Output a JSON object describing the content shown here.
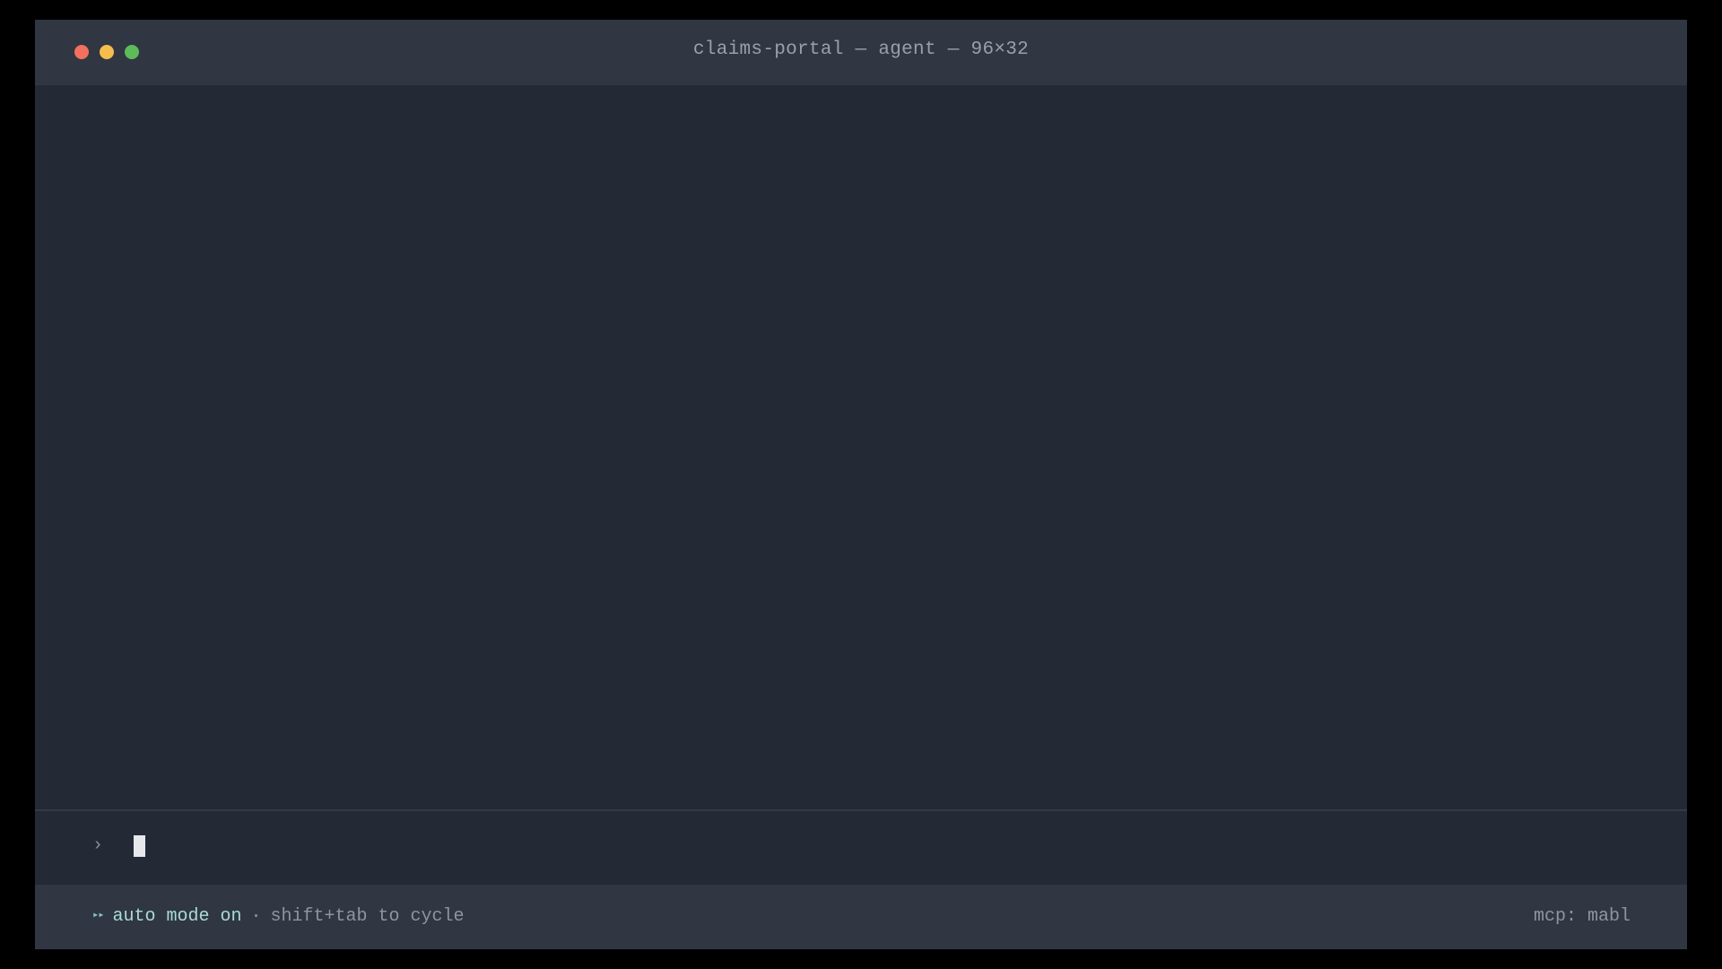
{
  "window": {
    "title": "claims-portal — agent — 96×32"
  },
  "prompt": {
    "caret": "›",
    "value": ""
  },
  "status": {
    "mode_icon": "▸▸",
    "mode_label": "auto mode on",
    "separator": "·",
    "hint": "shift+tab to cycle",
    "mcp": "mcp: mabl"
  },
  "colors": {
    "background": "#232a35",
    "titlebar": "#303642",
    "close": "#f2705d",
    "minimize": "#f5bd4c",
    "maximize": "#5dbb5a",
    "accent": "#a8dcd8"
  }
}
